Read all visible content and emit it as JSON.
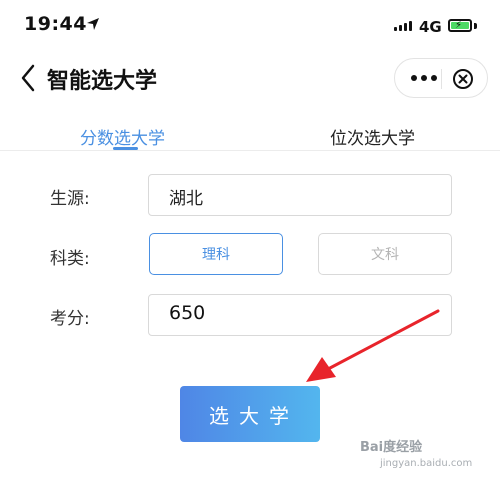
{
  "status_bar": {
    "time": "19:44",
    "network": "4G",
    "battery_color": "#4cd964"
  },
  "nav": {
    "title": "智能选大学",
    "back_icon": "chevron-left-icon",
    "more_icon": "more-icon",
    "close_icon": "close-circle-icon"
  },
  "tabs": [
    {
      "label": "分数选大学",
      "active": true
    },
    {
      "label": "位次选大学",
      "active": false
    }
  ],
  "form": {
    "province_label": "生源:",
    "province_value": "湖北",
    "subject_label": "科类:",
    "subject_options": [
      {
        "label": "理科",
        "selected": true
      },
      {
        "label": "文科",
        "selected": false
      }
    ],
    "score_label": "考分:",
    "score_value": "650"
  },
  "submit_label": "选大学",
  "annotation": {
    "arrow_color": "#e8242b"
  },
  "watermark": {
    "text": "Bai度经验",
    "sub": "jingyan.baidu.com"
  },
  "colors": {
    "accent": "#4a90e2",
    "button_start": "#4f86e6",
    "button_end": "#53b6ee"
  }
}
